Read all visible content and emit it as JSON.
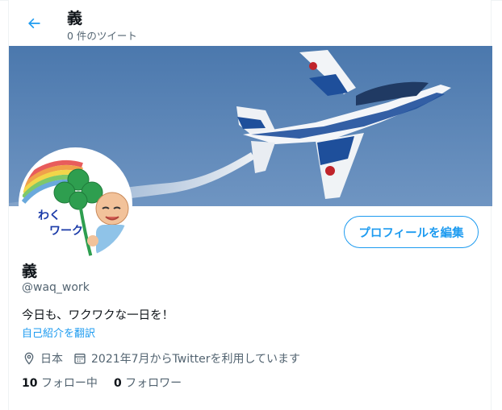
{
  "header": {
    "name": "義",
    "tweet_count": "0 件のツイート"
  },
  "profile": {
    "display_name": "義",
    "handle": "@waq_work",
    "bio": "今日も、ワクワクな一日を！",
    "translate_label": "自己紹介を翻訳",
    "location": "日本",
    "joined": "2021年7月からTwitterを利用しています",
    "edit_button": "プロフィールを編集",
    "avatar_text": [
      "わく",
      "ワーク"
    ]
  },
  "follow": {
    "following_count": "10",
    "following_label": "フォロー中",
    "followers_count": "0",
    "followers_label": "フォロワー"
  },
  "icons": {
    "back": "arrow-left-icon",
    "location": "location-pin-icon",
    "calendar": "calendar-icon"
  },
  "colors": {
    "accent": "#1d9bf0",
    "secondary_text": "#536471",
    "sky": "#4d7ab0"
  }
}
